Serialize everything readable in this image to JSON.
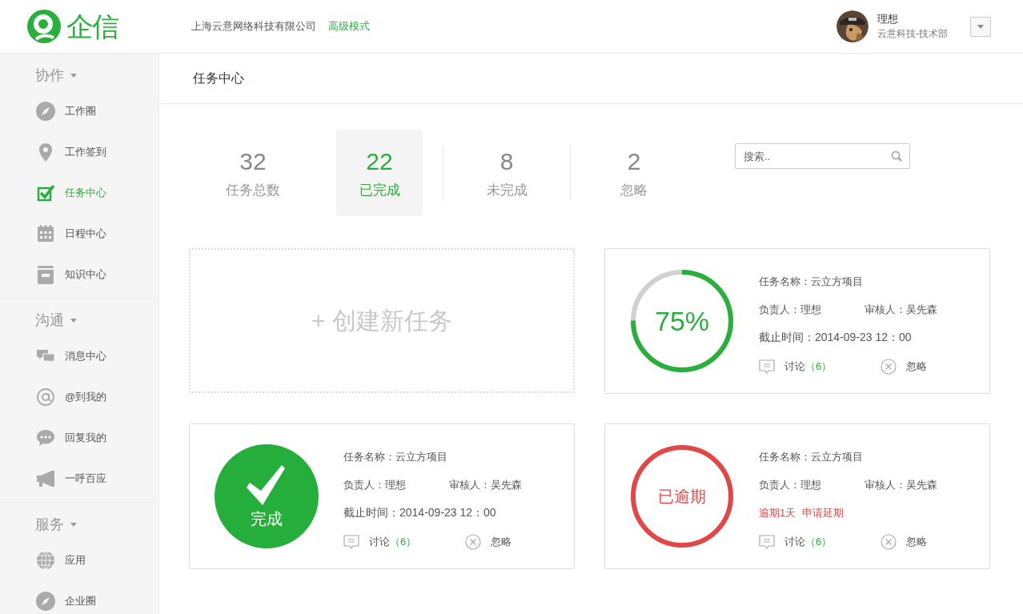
{
  "header": {
    "logo": "企信",
    "company": "上海云意网络科技有限公司",
    "mode_link": "高级模式",
    "user": {
      "name": "理想",
      "department": "云意科技-技术部"
    }
  },
  "sidebar": {
    "groups": [
      {
        "title": "协作",
        "expanded": true,
        "items": [
          {
            "label": "工作圈",
            "selected": false
          },
          {
            "label": "工作签到",
            "selected": false
          },
          {
            "label": "任务中心",
            "selected": true
          },
          {
            "label": "日程中心",
            "selected": false
          },
          {
            "label": "知识中心",
            "selected": false
          }
        ]
      },
      {
        "title": "沟通",
        "expanded": true,
        "items": [
          {
            "label": "消息中心",
            "selected": false
          },
          {
            "label": "@到我的",
            "selected": false
          },
          {
            "label": "回复我的",
            "selected": false
          },
          {
            "label": "一呼百应",
            "selected": false
          }
        ]
      },
      {
        "title": "服务",
        "expanded": true,
        "items": [
          {
            "label": "应用",
            "selected": false
          },
          {
            "label": "企业圈",
            "selected": false
          }
        ]
      }
    ]
  },
  "page_title": "任务中心",
  "stats": [
    {
      "value": "32",
      "label": "任务总数",
      "selected": false
    },
    {
      "value": "22",
      "label": "已完成",
      "selected": true
    },
    {
      "value": "8",
      "label": "未完成",
      "selected": false
    },
    {
      "value": "2",
      "label": "忽略",
      "selected": false
    }
  ],
  "search": {
    "placeholder": "搜索.."
  },
  "create_task": "+ 创建新任务",
  "tasks": [
    {
      "kind": "progress",
      "badge": "75%",
      "level": 0.75,
      "name": "任务名称：云立方项目",
      "owner": "负责人：理想",
      "reviewer": "审核人：吴先森",
      "deadline": "截止时间：2014-09-23 12：00",
      "discuss": "讨论",
      "discuss_count": "（6）",
      "ignore": "忽略"
    },
    {
      "kind": "done",
      "badge": "完成",
      "name": "任务名称：云立方项目",
      "owner": "负责人：理想",
      "reviewer": "审核人：吴先森",
      "deadline": "截止时间：2014-09-23 12：00",
      "discuss": "讨论",
      "discuss_count": "（6）",
      "ignore": "忽略"
    },
    {
      "kind": "overdue",
      "badge": "已逾期",
      "name": "任务名称：云立方项目",
      "owner": "负责人：理想",
      "reviewer": "审核人：吴先森",
      "overdue_note": "逾期1天",
      "extend_link": "申请延期",
      "discuss": "讨论",
      "discuss_count": "（6）",
      "ignore": "忽略"
    }
  ]
}
